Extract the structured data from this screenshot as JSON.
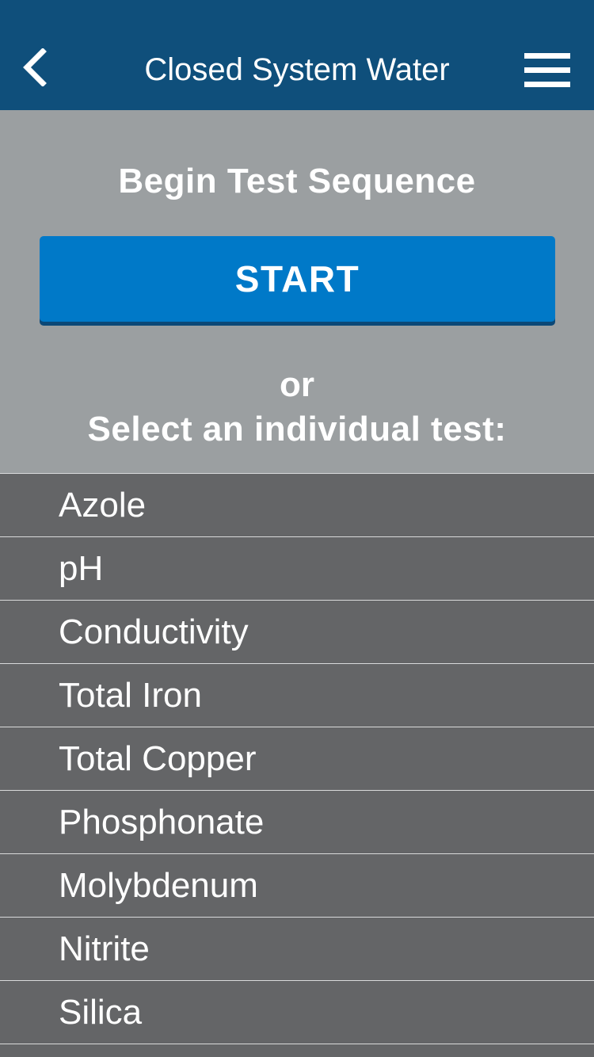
{
  "nav": {
    "title": "Closed System Water",
    "back_icon": "chevron-left-icon",
    "menu_icon": "hamburger-menu-icon"
  },
  "header": {
    "heading": "Begin Test Sequence",
    "start_label": "START",
    "or_label": "or",
    "select_label": "Select an individual test:"
  },
  "tests": [
    {
      "label": "Azole"
    },
    {
      "label": "pH"
    },
    {
      "label": "Conductivity"
    },
    {
      "label": "Total Iron"
    },
    {
      "label": "Total Copper"
    },
    {
      "label": "Phosphonate"
    },
    {
      "label": "Molybdenum"
    },
    {
      "label": "Nitrite"
    },
    {
      "label": "Silica"
    }
  ],
  "colors": {
    "nav_bar": "#0f4f7b",
    "header_panel": "#9b9fa1",
    "start_button": "#0079c8",
    "list_background": "#646567",
    "divider": "#d9dadb",
    "text": "#ffffff"
  }
}
